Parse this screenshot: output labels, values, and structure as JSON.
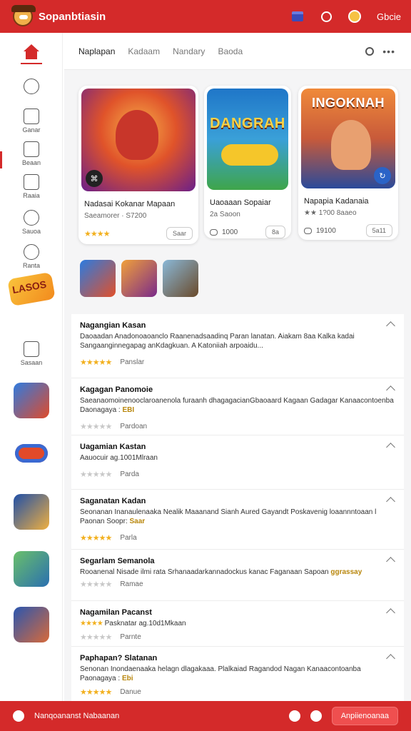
{
  "header": {
    "title": "Sopanbtiasin",
    "user": "Gbcie"
  },
  "tabs": [
    "Naplapan",
    "Kadaam",
    "Nandary",
    "Baoda"
  ],
  "rail": {
    "items": [
      {
        "label": ""
      },
      {
        "label": ""
      },
      {
        "label": "Ganar"
      },
      {
        "label": "Beaan"
      },
      {
        "label": "Raaia"
      },
      {
        "label": "Sauoa"
      },
      {
        "label": "Ranta"
      },
      {
        "label": "Sasaan"
      }
    ],
    "badge_text": "LASOS"
  },
  "featured": [
    {
      "title": "Nadasai Kokanar Mapaan",
      "sub": "Saeamorer · S7200",
      "rating": 4,
      "pill": "Saar",
      "art_word": ""
    },
    {
      "title": "Uaoaaan Sopaiar",
      "sub": "2a Saoon",
      "meta": "1000",
      "pill": "8a",
      "art_word": "DANGRAH"
    },
    {
      "title": "Napapia Kadanaia",
      "sub": "★★ 1?00 8aaeo",
      "meta": "19100",
      "pill": "5a11",
      "art_word": "INGOKNAH"
    }
  ],
  "list": [
    {
      "title": "Nagangian Kasan",
      "desc": "Daoaadan Anadonoaoanclo Raanenadsaadinq Paran lanatan. Aiakam 8aa Kalka kadai Sangaanginnegapag anKdagkuan. A Katoniiah arpoaidu...",
      "highlight": "",
      "rating": 4,
      "label": "Panslar"
    },
    {
      "title": "Kagagan Panomoie",
      "desc": "Saeanaomoinenooclaroanenola furaanh dhagagacianGbaoaard Kagaan Gadagar Kanaacontoenba Daonagaya :",
      "highlight": "EBI",
      "rating": 0,
      "label": "Pardoan"
    },
    {
      "title": "Uagamian Kastan",
      "desc": "Aauocuir ag.1001Mlraan",
      "highlight": "",
      "rating": 0,
      "label": "Parda"
    },
    {
      "title": "Saganatan Kadan",
      "desc": "Seonanan Inanaulenaaka Nealik Maaanand Sianh Aured Gayandt Poskavenig loaannntoaan l Paonan Soopr:",
      "highlight": "Saar",
      "rating": 4,
      "label": "Parla"
    },
    {
      "title": "Segarlam Semanola",
      "desc": "Rooanenal Nisade ilmi rata Srhanaadarkannadockus kanac Faganaan Sapoan",
      "highlight": "ggrassay",
      "rating": 0,
      "label": "Ramae"
    },
    {
      "title": "Nagamilan Pacanst",
      "desc": "Pasknatar ag.10d1Mkaan",
      "highlight": "",
      "rating": 0,
      "label": "Parnte"
    },
    {
      "title": "Paphapan? Slatanan",
      "desc": "Senonan Inondaenaaka helagn dlagakaaa. Plalkaiad Ragandod Nagan Kanaacontoanba Paonagaya :",
      "highlight": "Ebi",
      "rating": 4,
      "label": "Danue"
    }
  ],
  "bottombar": {
    "label": "Nanqoananst Nabaanan",
    "button": "Anpiienoanaa"
  }
}
